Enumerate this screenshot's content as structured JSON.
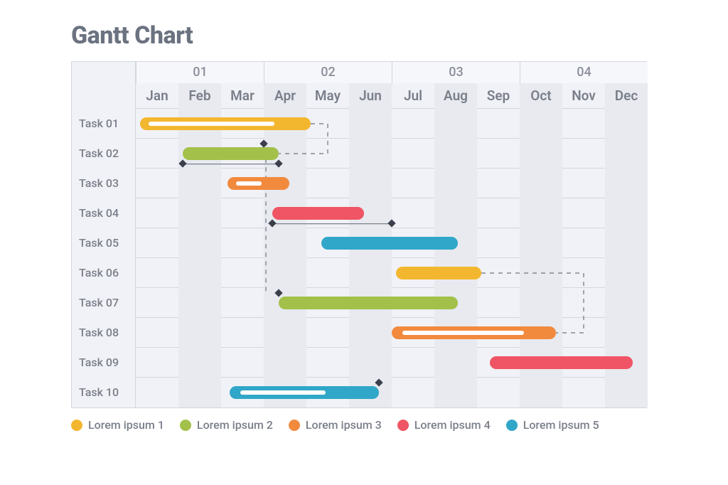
{
  "title": "Gantt Chart",
  "quarters": [
    "01",
    "02",
    "03",
    "04"
  ],
  "months": [
    "Jan",
    "Feb",
    "Mar",
    "Apr",
    "May",
    "Jun",
    "Jul",
    "Aug",
    "Sep",
    "Oct",
    "Nov",
    "Dec"
  ],
  "tasks": [
    "Task 01",
    "Task 02",
    "Task 03",
    "Task 04",
    "Task 05",
    "Task 06",
    "Task 07",
    "Task 08",
    "Task 09",
    "Task 10"
  ],
  "colors": {
    "c1": "#f3b72f",
    "c2": "#a3c14a",
    "c3": "#f28a3e",
    "c4": "#ef5564",
    "c5": "#30a7c8"
  },
  "legend": [
    {
      "label": "Lorem ipsum 1",
      "color": "c1"
    },
    {
      "label": "Lorem ipsum 2",
      "color": "c2"
    },
    {
      "label": "Lorem ipsum 3",
      "color": "c3"
    },
    {
      "label": "Lorem ipsum 4",
      "color": "c4"
    },
    {
      "label": "Lorem ipsum 5",
      "color": "c5"
    }
  ],
  "chart_data": {
    "type": "gantt",
    "unit": "month",
    "x_domain": {
      "start": 0,
      "end": 12
    },
    "rows": [
      "Task 01",
      "Task 02",
      "Task 03",
      "Task 04",
      "Task 05",
      "Task 06",
      "Task 07",
      "Task 08",
      "Task 09",
      "Task 10"
    ],
    "bars": [
      {
        "row": 0,
        "start": 0.1,
        "end": 4.1,
        "color": "c1",
        "progress_white_from": 0.3,
        "progress_white_to": 3.25
      },
      {
        "row": 1,
        "start": 1.1,
        "end": 3.35,
        "color": "c2"
      },
      {
        "row": 2,
        "start": 2.15,
        "end": 3.6,
        "color": "c3",
        "progress_white_from": 2.35,
        "progress_white_to": 2.95
      },
      {
        "row": 3,
        "start": 3.2,
        "end": 5.35,
        "color": "c4"
      },
      {
        "row": 4,
        "start": 4.35,
        "end": 7.55,
        "color": "c5"
      },
      {
        "row": 5,
        "start": 6.1,
        "end": 8.1,
        "color": "c1"
      },
      {
        "row": 6,
        "start": 3.35,
        "end": 7.55,
        "color": "c2"
      },
      {
        "row": 7,
        "start": 6.0,
        "end": 9.85,
        "color": "c3",
        "progress_white_from": 6.25,
        "progress_white_to": 9.1
      },
      {
        "row": 8,
        "start": 8.3,
        "end": 11.65,
        "color": "c4"
      },
      {
        "row": 9,
        "start": 2.2,
        "end": 5.7,
        "color": "c5",
        "progress_white_from": 2.45,
        "progress_white_to": 4.45
      }
    ],
    "milestones": [
      {
        "row": 1,
        "x": 3.0,
        "edge": "top"
      },
      {
        "row": 1,
        "x": 1.1,
        "edge": "bot"
      },
      {
        "row": 1,
        "x": 3.35,
        "edge": "bot"
      },
      {
        "row": 3,
        "x": 3.2,
        "edge": "bot"
      },
      {
        "row": 3,
        "x": 6.0,
        "edge": "bot"
      },
      {
        "row": 6,
        "x": 3.35,
        "edge": "top"
      },
      {
        "row": 9,
        "x": 5.7,
        "edge": "top"
      }
    ],
    "dependencies": [
      {
        "path": [
          [
            4.1,
            0.5
          ],
          [
            4.5,
            0.5
          ],
          [
            4.5,
            1.5
          ],
          [
            3.35,
            1.5
          ]
        ],
        "style": "dashed"
      },
      {
        "path": [
          [
            1.1,
            1.85
          ],
          [
            3.35,
            1.85
          ]
        ],
        "style": "solid"
      },
      {
        "path": [
          [
            3.05,
            1.1
          ],
          [
            3.05,
            6.1
          ]
        ],
        "style": "dashed"
      },
      {
        "path": [
          [
            3.2,
            3.85
          ],
          [
            6.0,
            3.85
          ]
        ],
        "style": "solid"
      },
      {
        "path": [
          [
            8.1,
            5.5
          ],
          [
            10.5,
            5.5
          ],
          [
            10.5,
            7.5
          ],
          [
            9.85,
            7.5
          ]
        ],
        "style": "dashed"
      }
    ]
  }
}
